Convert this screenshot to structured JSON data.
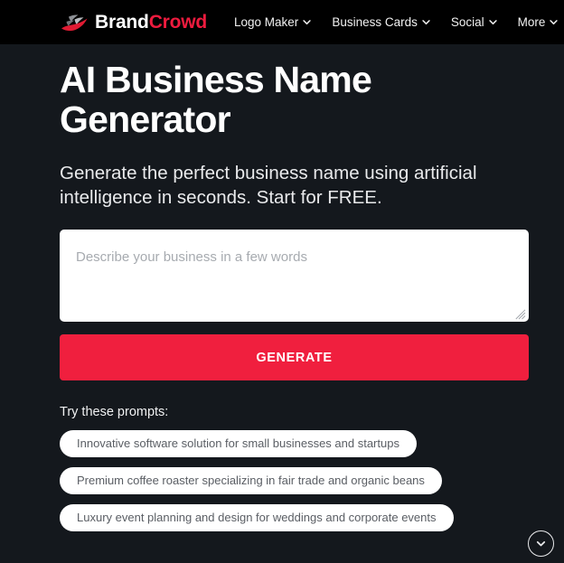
{
  "header": {
    "logo": {
      "mark_icon": "brandcrowd-swoosh-icon",
      "word_part_1": "Brand",
      "word_part_2": "Crowd",
      "word_color_1": "#ffffff",
      "word_color_2": "#ee1b3e"
    },
    "nav": [
      {
        "label": "Logo Maker",
        "icon": "chevron-down-icon"
      },
      {
        "label": "Business Cards",
        "icon": "chevron-down-icon"
      },
      {
        "label": "Social",
        "icon": "chevron-down-icon"
      },
      {
        "label": "More",
        "icon": "chevron-down-icon"
      }
    ]
  },
  "hero": {
    "title": "AI Business Name Generator",
    "subtitle": "Generate the perfect business name using artificial intelligence in seconds. Start for FREE."
  },
  "form": {
    "describe_placeholder": "Describe your business in a few words",
    "describe_value": "",
    "generate_label": "GENERATE",
    "generate_color": "#f01f3e"
  },
  "prompts": {
    "label": "Try these prompts:",
    "items": [
      "Innovative software solution for small businesses and startups",
      "Premium coffee roaster specializing in fair trade and organic beans",
      "Luxury event planning and design for weddings and corporate events"
    ]
  },
  "footer": {
    "scroll_down_icon": "chevron-down-icon"
  },
  "theme": {
    "header_bg": "#000000",
    "page_bg": "#14181d",
    "accent": "#f01f3e",
    "text": "#ffffff"
  }
}
